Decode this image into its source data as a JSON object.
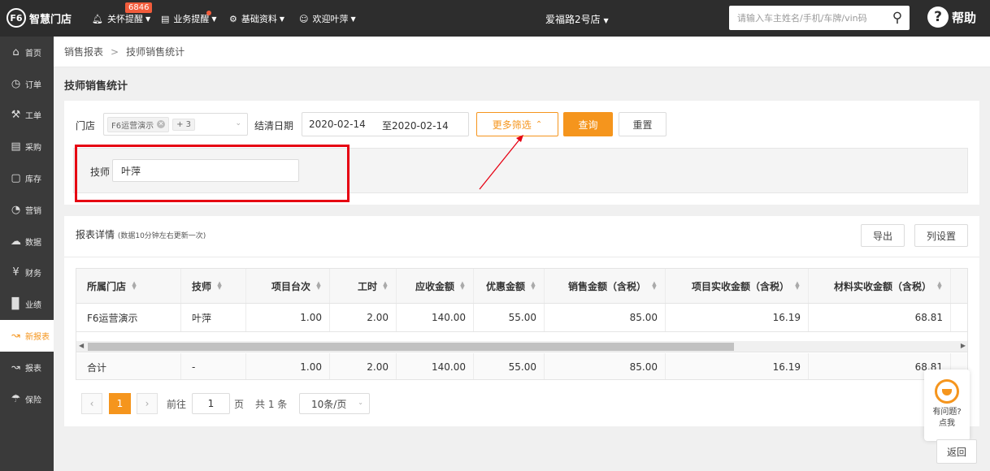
{
  "app": {
    "logo_mark": "F6",
    "brand": "智慧门店",
    "shop": "爱福路2号店"
  },
  "topnav": [
    {
      "label": "关怀提醒",
      "icon": "bell-icon"
    },
    {
      "label": "业务提醒",
      "icon": "clipboard-icon"
    },
    {
      "label": "基础资料",
      "icon": "gear-icon"
    },
    {
      "label": "欢迎叶萍",
      "icon": "user-icon"
    }
  ],
  "care_badge": "6846",
  "search": {
    "placeholder": "请输入车主姓名/手机/车牌/vin码"
  },
  "help_label": "帮助",
  "sidebar": [
    {
      "label": "首页",
      "icon": "home-icon"
    },
    {
      "label": "订单",
      "icon": "clock-icon"
    },
    {
      "label": "工单",
      "icon": "wrench-icon"
    },
    {
      "label": "采购",
      "icon": "cart-icon"
    },
    {
      "label": "库存",
      "icon": "box-icon"
    },
    {
      "label": "营销",
      "icon": "pie-icon"
    },
    {
      "label": "数据",
      "icon": "cloud-icon"
    },
    {
      "label": "财务",
      "icon": "yen-icon"
    },
    {
      "label": "业绩",
      "icon": "bar-chart-icon"
    },
    {
      "label": "新报表",
      "icon": "line-chart-icon",
      "active": true
    },
    {
      "label": "报表",
      "icon": "report-icon"
    },
    {
      "label": "保险",
      "icon": "umbrella-icon"
    }
  ],
  "breadcrumb": {
    "parent": "销售报表",
    "current": "技师销售统计"
  },
  "page_title": "技师销售统计",
  "filters": {
    "store_label": "门店",
    "store_tag": "F6运营演示",
    "store_more": "+ 3",
    "date_label": "结清日期",
    "date_start": "2020-02-14",
    "date_end": "至2020-02-14",
    "more_label": "更多筛选",
    "query_label": "查询",
    "reset_label": "重置",
    "tech_label": "技师",
    "tech_value": "叶萍"
  },
  "report": {
    "title": "报表详情",
    "note": "(数据10分钟左右更新一次)",
    "export_label": "导出",
    "columns_label": "列设置"
  },
  "table": {
    "headers": [
      "所属门店",
      "技师",
      "项目台次",
      "工时",
      "应收金额",
      "优惠金额",
      "销售金额（含税）",
      "项目实收金额（含税）",
      "材料实收金额（含税）"
    ],
    "rows": [
      [
        "F6运营演示",
        "叶萍",
        "1.00",
        "2.00",
        "140.00",
        "55.00",
        "85.00",
        "16.19",
        "68.81"
      ]
    ],
    "total": [
      "合计",
      "-",
      "1.00",
      "2.00",
      "140.00",
      "55.00",
      "85.00",
      "16.19",
      "68.81"
    ]
  },
  "pagination": {
    "current": "1",
    "goto_prefix": "前往",
    "goto_value": "1",
    "goto_suffix": "页",
    "total_text": "共 1 条",
    "page_size": "10条/页"
  },
  "chat": {
    "line1": "有问题?",
    "line2": "点我"
  },
  "back_label": "返回",
  "colors": {
    "accent": "#f5951d",
    "topbar": "#2d2d2d",
    "sidebar": "#3a3a3a",
    "highlight": "#e60012"
  }
}
